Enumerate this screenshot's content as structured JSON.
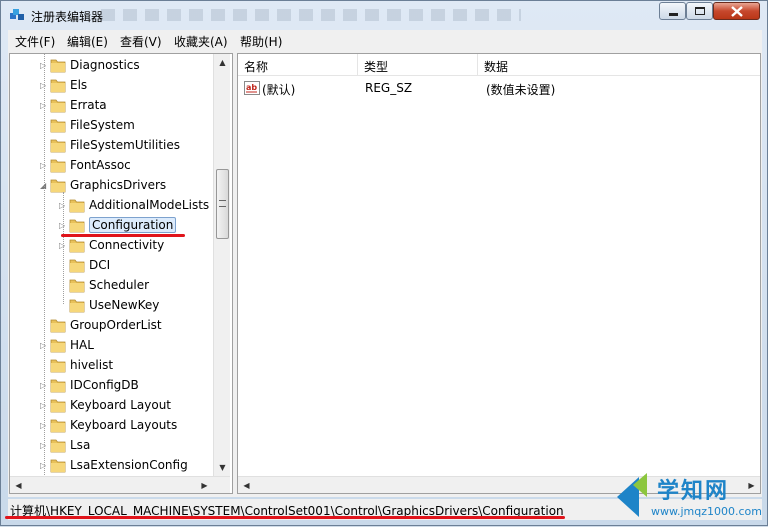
{
  "window": {
    "title": "注册表编辑器"
  },
  "menu": [
    "文件(F)",
    "编辑(E)",
    "查看(V)",
    "收藏夹(A)",
    "帮助(H)"
  ],
  "tree": [
    {
      "label": "Diagnostics",
      "level": 1,
      "expander": "▷"
    },
    {
      "label": "Els",
      "level": 1,
      "expander": "▷"
    },
    {
      "label": "Errata",
      "level": 1,
      "expander": "▷"
    },
    {
      "label": "FileSystem",
      "level": 1,
      "expander": ""
    },
    {
      "label": "FileSystemUtilities",
      "level": 1,
      "expander": ""
    },
    {
      "label": "FontAssoc",
      "level": 1,
      "expander": "▷"
    },
    {
      "label": "GraphicsDrivers",
      "level": 1,
      "expander": "◢"
    },
    {
      "label": "AdditionalModeLists",
      "level": 2,
      "expander": "▷"
    },
    {
      "label": "Configuration",
      "level": 2,
      "expander": "▷",
      "selected": true
    },
    {
      "label": "Connectivity",
      "level": 2,
      "expander": "▷"
    },
    {
      "label": "DCI",
      "level": 2,
      "expander": ""
    },
    {
      "label": "Scheduler",
      "level": 2,
      "expander": ""
    },
    {
      "label": "UseNewKey",
      "level": 2,
      "expander": ""
    },
    {
      "label": "GroupOrderList",
      "level": 1,
      "expander": ""
    },
    {
      "label": "HAL",
      "level": 1,
      "expander": "▷"
    },
    {
      "label": "hivelist",
      "level": 1,
      "expander": ""
    },
    {
      "label": "IDConfigDB",
      "level": 1,
      "expander": "▷"
    },
    {
      "label": "Keyboard Layout",
      "level": 1,
      "expander": "▷"
    },
    {
      "label": "Keyboard Layouts",
      "level": 1,
      "expander": "▷"
    },
    {
      "label": "Lsa",
      "level": 1,
      "expander": "▷"
    },
    {
      "label": "LsaExtensionConfig",
      "level": 1,
      "expander": "▷"
    }
  ],
  "list": {
    "columns": [
      "名称",
      "类型",
      "数据"
    ],
    "rows": [
      {
        "name": "(默认)",
        "type": "REG_SZ",
        "data": "(数值未设置)",
        "icon": "string-value-icon"
      }
    ]
  },
  "status": {
    "path": "计算机\\HKEY_LOCAL_MACHINE\\SYSTEM\\ControlSet001\\Control\\GraphicsDrivers\\Configuration"
  },
  "watermark": {
    "text": "学知网",
    "url": "www.jmqz1000.com"
  },
  "colors": {
    "highlight": "#e0141b",
    "selection": "#dcebfc",
    "watermark": "#1e84c8"
  }
}
